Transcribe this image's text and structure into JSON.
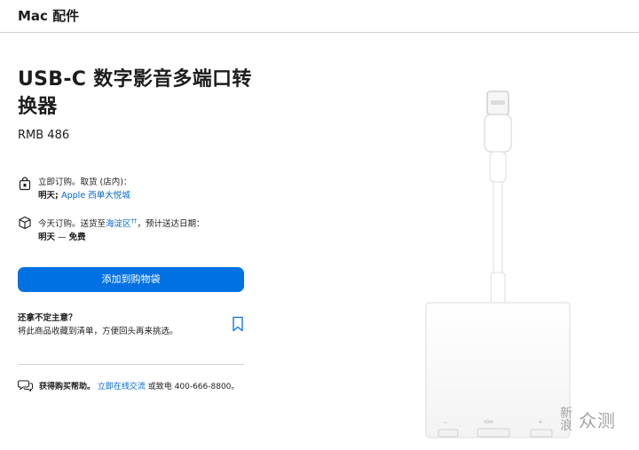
{
  "header": {
    "title": "Mac 配件"
  },
  "product": {
    "title": "USB-C 数字影音多端口转换器",
    "price": "RMB 486"
  },
  "pickup": {
    "line1": "立即订购。取货 (店内)：",
    "day": "明天",
    "store": "Apple 西单大悦城"
  },
  "delivery": {
    "line1_prefix": "今天订购。送货至",
    "district": "海淀区",
    "marker": "††",
    "line1_suffix": "，预计送达日期：",
    "day": "明天",
    "dash": "—",
    "cost": "免费"
  },
  "actions": {
    "add_to_bag": "添加到购物袋"
  },
  "save": {
    "title": "还拿不定主意？",
    "desc": "将此商品收藏到清单，方便回头再来挑选。"
  },
  "help": {
    "label": "获得购买帮助。",
    "chat_link": "立即在线交流",
    "suffix": "或致电 400-666-8800。"
  },
  "image": {
    "port_labels": [
      "HDMI"
    ]
  },
  "watermark": {
    "line_a": "新",
    "line_b": "浪",
    "text": "众测"
  },
  "colors": {
    "accent": "#0071e3",
    "link": "#0066cc",
    "text": "#1d1d1f"
  },
  "icons": [
    "bag-icon",
    "box-icon",
    "bookmark-icon",
    "chat-icon"
  ]
}
